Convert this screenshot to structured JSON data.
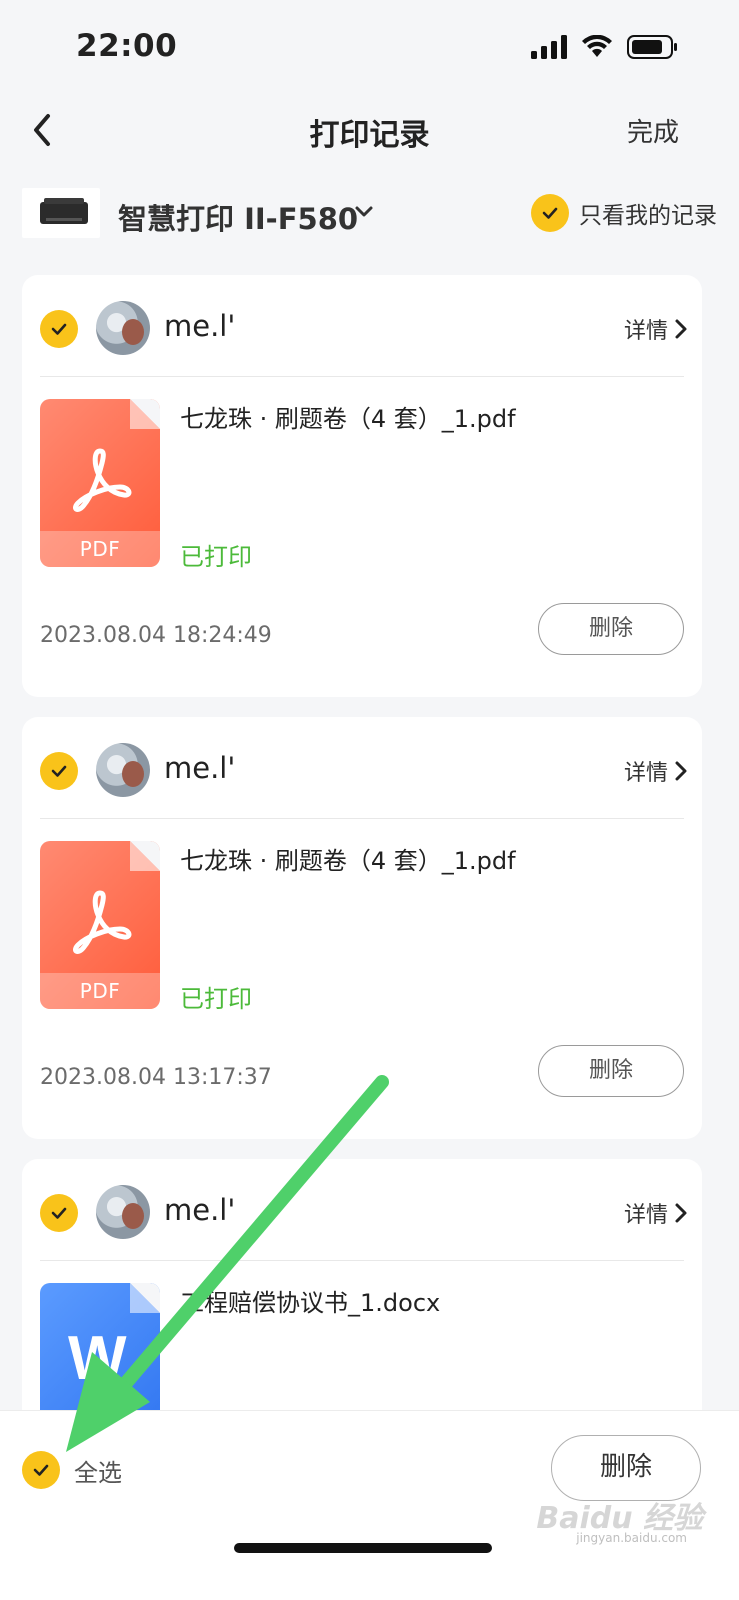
{
  "status_bar": {
    "time": "22:00"
  },
  "nav": {
    "title": "打印记录",
    "done_label": "完成"
  },
  "device": {
    "name": "智慧打印 II-F580",
    "only_mine_label": "只看我的记录"
  },
  "records": [
    {
      "username": "me.l'",
      "details_label": "详情",
      "file_name": "七龙珠 · 刷题卷（4 套）_1.pdf",
      "file_type": "PDF",
      "status": "已打印",
      "timestamp": "2023.08.04 18:24:49",
      "delete_label": "删除"
    },
    {
      "username": "me.l'",
      "details_label": "详情",
      "file_name": "七龙珠 · 刷题卷（4 套）_1.pdf",
      "file_type": "PDF",
      "status": "已打印",
      "timestamp": "2023.08.04 13:17:37",
      "delete_label": "删除"
    },
    {
      "username": "me.l'",
      "details_label": "详情",
      "file_name": "工程赔偿协议书_1.docx",
      "file_type_glyph": "W"
    }
  ],
  "bottom": {
    "select_all_label": "全选",
    "delete_label": "删除"
  },
  "watermark": {
    "brand": "Baidu 经验",
    "url": "jingyan.baidu.com"
  },
  "colors": {
    "accent": "#f9c31a",
    "printed": "#4cba3a",
    "arrow": "#4fd06a",
    "pdf": "#ff5c3a",
    "doc": "#2f74f0"
  },
  "icons": [
    "back-arrow-icon",
    "chevron-down-icon",
    "check-icon",
    "chevron-right-icon",
    "pdf-icon",
    "word-icon",
    "signal-icon",
    "wifi-icon",
    "battery-icon"
  ]
}
